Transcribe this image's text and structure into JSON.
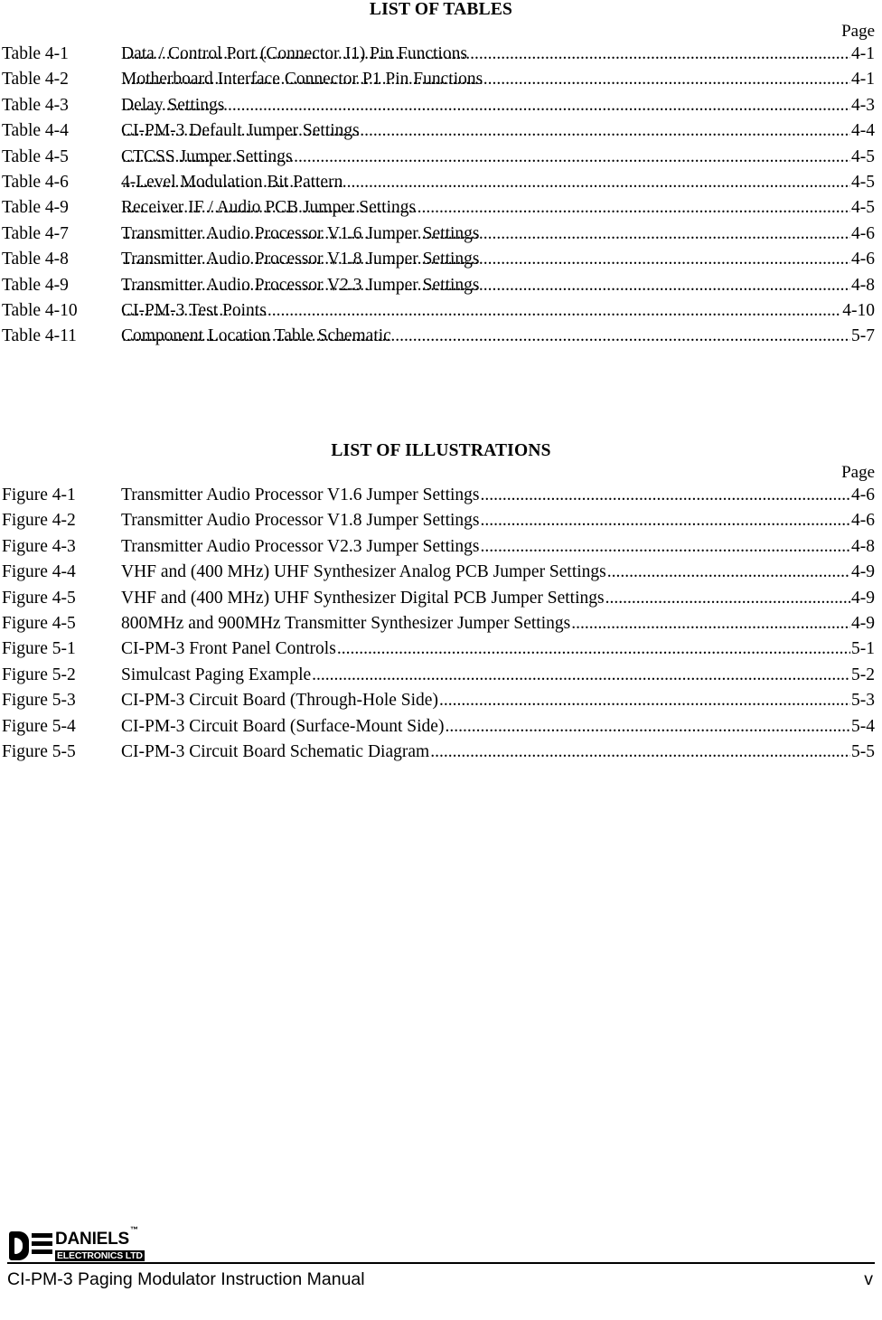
{
  "tables_section": {
    "heading": "LIST OF TABLES",
    "page_column_label": "Page",
    "rows": [
      {
        "label": "Table 4-1",
        "title": "Data / Control Port (Connector J1) Pin Functions",
        "page": "4-1"
      },
      {
        "label": "Table 4-2",
        "title": "Motherboard Interface Connector P1 Pin Functions",
        "page": "4-1"
      },
      {
        "label": "Table 4-3",
        "title": "Delay Settings",
        "page": "4-3"
      },
      {
        "label": "Table 4-4",
        "title": "CI-PM-3 Default Jumper Settings",
        "page": "4-4"
      },
      {
        "label": "Table 4-5",
        "title": "CTCSS Jumper Settings",
        "page": "4-5"
      },
      {
        "label": "Table 4-6",
        "title": "4-Level Modulation Bit Pattern",
        "page": "4-5"
      },
      {
        "label": "Table 4-9",
        "title": "Receiver IF / Audio PCB Jumper Settings",
        "page": "4-5"
      },
      {
        "label": "Table 4-7",
        "title": "Transmitter Audio Processor V1.6 Jumper Settings",
        "page": "4-6"
      },
      {
        "label": "Table 4-8",
        "title": "Transmitter Audio Processor V1.8 Jumper Settings",
        "page": "4-6"
      },
      {
        "label": "Table 4-9",
        "title": "Transmitter Audio Processor V2.3 Jumper Settings",
        "page": "4-8"
      },
      {
        "label": "Table 4-10",
        "title": "CI-PM-3 Test Points",
        "page": "4-10"
      },
      {
        "label": "Table 4-11",
        "title": "Component Location Table Schematic",
        "page": "5-7"
      }
    ]
  },
  "illustrations_section": {
    "heading": "LIST OF ILLUSTRATIONS",
    "page_column_label": "Page",
    "rows": [
      {
        "label": "Figure 4-1",
        "title": "Transmitter Audio Processor V1.6 Jumper Settings",
        "page": "4-6"
      },
      {
        "label": "Figure 4-2",
        "title": "Transmitter Audio Processor V1.8 Jumper Settings",
        "page": "4-6"
      },
      {
        "label": "Figure 4-3",
        "title": "Transmitter Audio Processor V2.3 Jumper Settings",
        "page": "4-8"
      },
      {
        "label": "Figure 4-4",
        "title": "VHF and (400 MHz) UHF Synthesizer Analog PCB Jumper Settings",
        "page": "4-9"
      },
      {
        "label": "Figure 4-5",
        "title": "VHF and (400 MHz) UHF Synthesizer Digital PCB Jumper Settings",
        "page": "4-9"
      },
      {
        "label": "Figure 4-5",
        "title": "800MHz and 900MHz Transmitter Synthesizer Jumper Settings",
        "page": "4-9"
      },
      {
        "label": "Figure 5-1",
        "title": "CI-PM-3 Front Panel Controls",
        "page": "5-1"
      },
      {
        "label": "Figure 5-2",
        "title": "Simulcast Paging Example",
        "page": "5-2"
      },
      {
        "label": "Figure 5-3",
        "title": "CI-PM-3 Circuit Board (Through-Hole Side)",
        "page": "5-3"
      },
      {
        "label": "Figure 5-4",
        "title": "CI-PM-3 Circuit Board (Surface-Mount Side)",
        "page": "5-4"
      },
      {
        "label": "Figure 5-5",
        "title": "CI-PM-3 Circuit Board Schematic Diagram",
        "page": "5-5"
      }
    ]
  },
  "footer": {
    "logo_brand": "DANIELS",
    "logo_trademark": "™",
    "logo_sub": "ELECTRONICS LTD",
    "document_title": "CI-PM-3 Paging Modulator Instruction Manual",
    "page_number": "v"
  }
}
